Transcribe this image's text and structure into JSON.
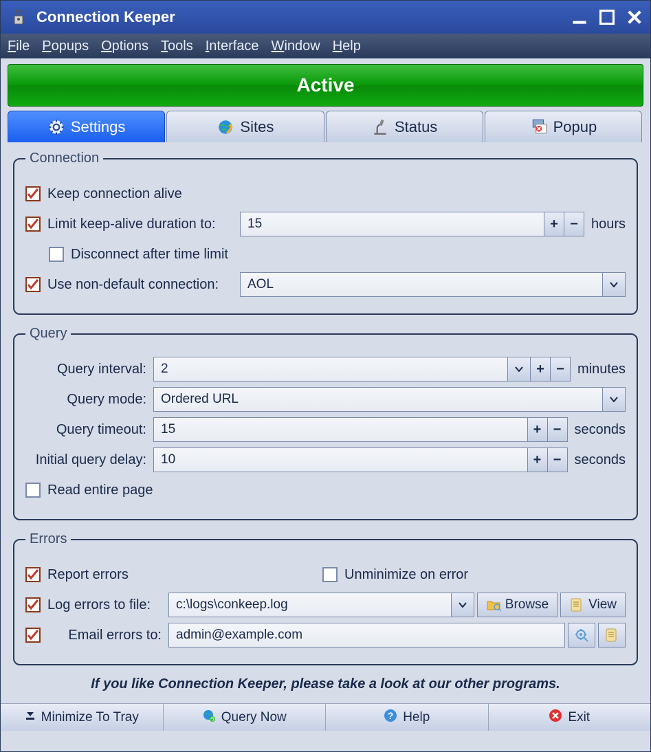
{
  "title": "Connection Keeper",
  "menubar": [
    "File",
    "Popups",
    "Options",
    "Tools",
    "Interface",
    "Window",
    "Help"
  ],
  "status": "Active",
  "tabs": [
    {
      "label": "Settings",
      "active": true
    },
    {
      "label": "Sites",
      "active": false
    },
    {
      "label": "Status",
      "active": false
    },
    {
      "label": "Popup",
      "active": false
    }
  ],
  "connection": {
    "legend": "Connection",
    "keep_alive": {
      "checked": true,
      "label": "Keep connection alive"
    },
    "limit_duration": {
      "checked": true,
      "label": "Limit keep-alive duration to:",
      "value": "15",
      "unit": "hours"
    },
    "disconnect_after": {
      "checked": false,
      "label": "Disconnect after time limit"
    },
    "use_nondefault": {
      "checked": true,
      "label": "Use non-default connection:",
      "value": "AOL"
    }
  },
  "query": {
    "legend": "Query",
    "interval": {
      "label": "Query interval:",
      "value": "2",
      "unit": "minutes"
    },
    "mode": {
      "label": "Query mode:",
      "value": "Ordered URL"
    },
    "timeout": {
      "label": "Query timeout:",
      "value": "15",
      "unit": "seconds"
    },
    "delay": {
      "label": "Initial query delay:",
      "value": "10",
      "unit": "seconds"
    },
    "read_entire": {
      "checked": false,
      "label": "Read entire page"
    }
  },
  "errors": {
    "legend": "Errors",
    "report": {
      "checked": true,
      "label": "Report errors"
    },
    "unminimize": {
      "checked": false,
      "label": "Unminimize on error"
    },
    "log": {
      "checked": true,
      "label": "Log errors to file:",
      "value": "c:\\logs\\conkeep.log",
      "browse": "Browse",
      "view": "View"
    },
    "email": {
      "checked": true,
      "label": "Email errors to:",
      "value": "admin@example.com"
    }
  },
  "promo": "If you like Connection Keeper, please take a look at our other programs.",
  "footer": {
    "minimize": "Minimize To Tray",
    "query_now": "Query Now",
    "help": "Help",
    "exit": "Exit"
  }
}
